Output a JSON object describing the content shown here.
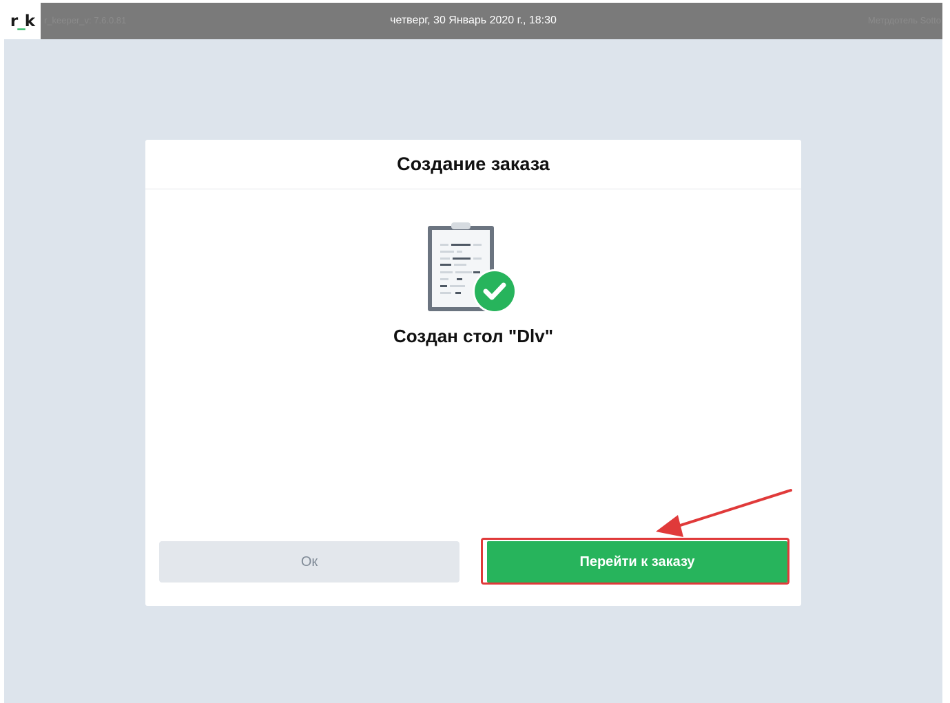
{
  "topbar": {
    "logo_left": "r",
    "logo_underscore": "_",
    "logo_right": "k",
    "version": "r_keeper_v: 7.6.0.81",
    "datetime": "четверг, 30 Январь 2020 г., 18:30",
    "user": "Метрдотель Sotto"
  },
  "dialog": {
    "title": "Создание заказа",
    "message": "Создан стол \"Dlv\"",
    "ok_label": "Ок",
    "go_label": "Перейти к заказу"
  },
  "colors": {
    "background": "#dde4ec",
    "topbar": "#7a7a7a",
    "primary_button": "#27b45c",
    "highlight": "#e03a3a"
  },
  "icons": {
    "illustration": "clipboard-check-icon",
    "annotation": "red-arrow"
  }
}
